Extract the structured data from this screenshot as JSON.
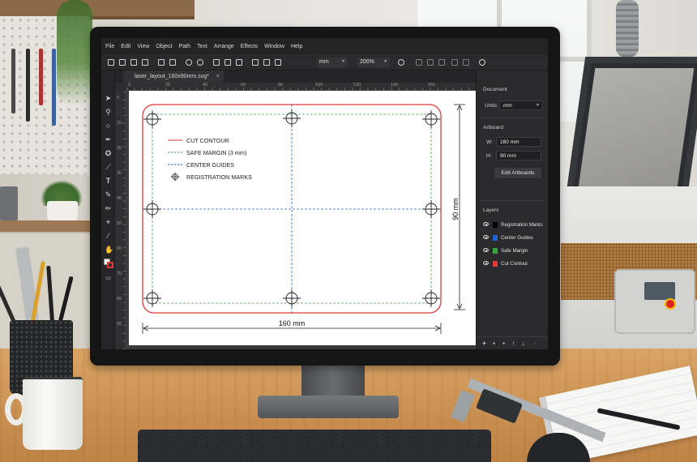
{
  "app": {
    "menu": [
      "File",
      "Edit",
      "View",
      "Object",
      "Path",
      "Text",
      "Arrange",
      "Effects",
      "Window",
      "Help"
    ],
    "units_select": "mm",
    "zoom_select": "200%",
    "tab": {
      "label": "laser_layout_160x90mm.svg*",
      "close": "×"
    }
  },
  "rulers": {
    "horizontal": [
      "0",
      "20",
      "40",
      "60",
      "80",
      "100",
      "120",
      "140",
      "160"
    ],
    "vertical": [
      "0",
      "10",
      "20",
      "30",
      "40",
      "50",
      "60",
      "70",
      "80",
      "90"
    ]
  },
  "artboard": {
    "legend": [
      {
        "label": "CUT CONTOUR",
        "style": "solid",
        "color": "#e53935"
      },
      {
        "label": "SAFE MARGIN (3 mm)",
        "style": "dashed",
        "color": "#43a047"
      },
      {
        "label": "CENTER GUIDES",
        "style": "dashed",
        "color": "#1e63d6"
      },
      {
        "label": "REGISTRATION MARKS",
        "style": "target",
        "color": "#222222"
      }
    ],
    "width_label": "160 mm",
    "height_label": "90 mm"
  },
  "document_panel": {
    "title": "Document",
    "units_label": "Units:",
    "units_value": "mm"
  },
  "artboard_panel": {
    "title": "Artboard",
    "w_label": "W:",
    "w_value": "160 mm",
    "h_label": "H:",
    "h_value": "90 mm",
    "edit_button": "Edit Artboards"
  },
  "layers_panel": {
    "title": "Layers",
    "layers": [
      {
        "name": "Registration Marks",
        "color": "#000000"
      },
      {
        "name": "Center Guides",
        "color": "#1e63d6"
      },
      {
        "name": "Safe Margin",
        "color": "#3aa53a"
      },
      {
        "name": "Cut Contour",
        "color": "#e53935"
      }
    ]
  }
}
